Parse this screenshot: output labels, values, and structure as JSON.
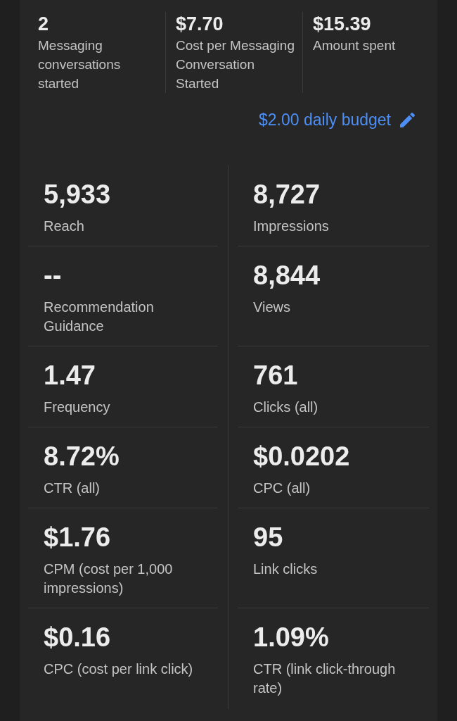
{
  "summary": [
    {
      "value": "2",
      "label": "Messaging conversations started"
    },
    {
      "value": "$7.70",
      "label": "Cost per Messaging Conversation Started"
    },
    {
      "value": "$15.39",
      "label": "Amount spent"
    }
  ],
  "budget": {
    "label": "$2.00 daily budget"
  },
  "metric_rows": [
    {
      "cells": [
        {
          "value": "5,933",
          "label": "Reach"
        },
        {
          "value": "8,727",
          "label": "Impressions"
        }
      ]
    },
    {
      "cells": [
        {
          "value": "--",
          "label": "Recommendation Guidance"
        },
        {
          "value": "8,844",
          "label": "Views"
        }
      ]
    },
    {
      "cells": [
        {
          "value": "1.47",
          "label": "Frequency"
        },
        {
          "value": "761",
          "label": "Clicks (all)"
        }
      ]
    },
    {
      "cells": [
        {
          "value": "8.72%",
          "label": "CTR (all)"
        },
        {
          "value": "$0.0202",
          "label": "CPC (all)"
        }
      ]
    },
    {
      "cells": [
        {
          "value": "$1.76",
          "label": "CPM (cost per 1,000 impressions)"
        },
        {
          "value": "95",
          "label": "Link clicks"
        }
      ]
    },
    {
      "cells": [
        {
          "value": "$0.16",
          "label": "CPC (cost per link click)"
        },
        {
          "value": "1.09%",
          "label": "CTR (link click-through rate)"
        }
      ]
    }
  ]
}
